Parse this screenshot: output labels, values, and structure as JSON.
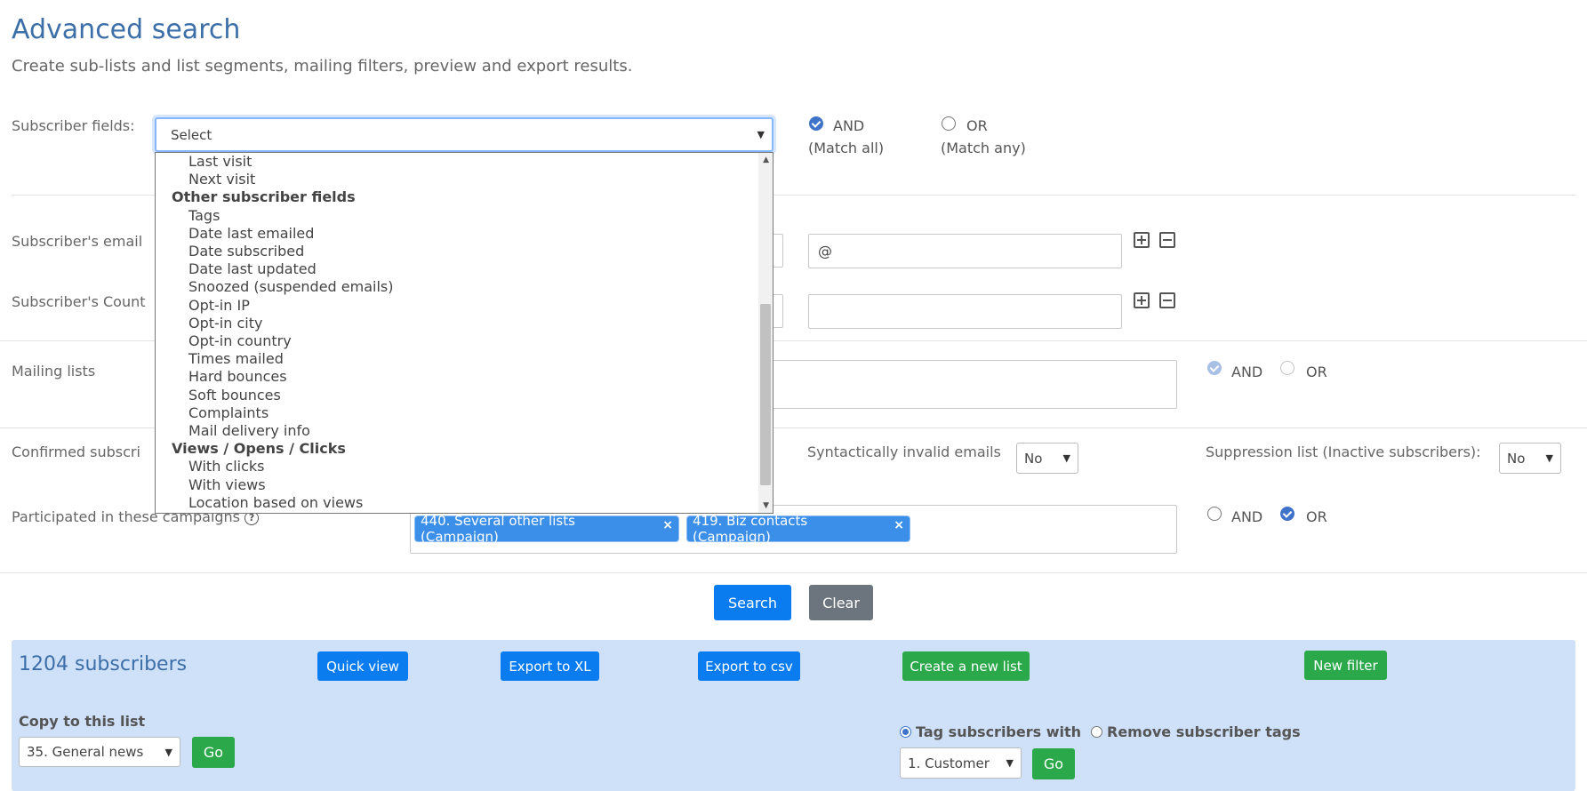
{
  "header": {
    "title": "Advanced search",
    "subtitle": "Create sub-lists and list segments, mailing filters, preview and export results."
  },
  "subscriber_fields": {
    "label": "Subscriber fields:",
    "select_value": "Select",
    "and_label": "AND",
    "and_sub": "(Match all)",
    "or_label": "OR",
    "or_sub": "(Match any)"
  },
  "dropdown": {
    "items": [
      {
        "type": "item",
        "label": "Last visit"
      },
      {
        "type": "item",
        "label": "Next visit"
      },
      {
        "type": "group",
        "label": "Other subscriber fields"
      },
      {
        "type": "item",
        "label": "Tags"
      },
      {
        "type": "item",
        "label": "Date last emailed"
      },
      {
        "type": "item",
        "label": "Date subscribed"
      },
      {
        "type": "item",
        "label": "Date last updated"
      },
      {
        "type": "item",
        "label": "Snoozed (suspended emails)"
      },
      {
        "type": "item",
        "label": "Opt-in IP"
      },
      {
        "type": "item",
        "label": "Opt-in city"
      },
      {
        "type": "item",
        "label": "Opt-in country"
      },
      {
        "type": "item",
        "label": "Times mailed"
      },
      {
        "type": "item",
        "label": "Hard bounces"
      },
      {
        "type": "item",
        "label": "Soft bounces"
      },
      {
        "type": "item",
        "label": "Complaints"
      },
      {
        "type": "item",
        "label": "Mail delivery info"
      },
      {
        "type": "group",
        "label": "Views / Opens / Clicks"
      },
      {
        "type": "item",
        "label": "With clicks"
      },
      {
        "type": "item",
        "label": "With views"
      },
      {
        "type": "item",
        "label": "Location based on views"
      }
    ]
  },
  "filters": {
    "email_label": "Subscriber's email",
    "email_value": "@",
    "country_label": "Subscriber's Count",
    "country_value": ""
  },
  "mailing_lists": {
    "label": "Mailing lists",
    "and_label": "AND",
    "or_label": "OR"
  },
  "confirmed": {
    "label": "Confirmed subscri",
    "invalid_label": "Syntactically invalid emails",
    "invalid_value": "No",
    "suppression_label": "Suppression list (Inactive subscribers):",
    "suppression_value": "No"
  },
  "campaigns": {
    "label": "Participated in these campaigns",
    "help_icon": "?",
    "tags": [
      "440. Several other lists (Campaign)",
      "419. Biz contacts (Campaign)"
    ],
    "tag_remove": "×",
    "and_label": "AND",
    "or_label": "OR"
  },
  "actions": {
    "search": "Search",
    "clear": "Clear"
  },
  "results": {
    "count_text": "1204 subscribers",
    "quick_view": "Quick view",
    "export_xl": "Export to XL",
    "export_csv": "Export to csv",
    "create_list": "Create a new list",
    "new_filter": "New filter",
    "copy_label": "Copy to this list",
    "copy_value": "35. General news",
    "copy_go": "Go",
    "tag_option": "Tag subscribers with",
    "remove_option": "Remove subscriber tags",
    "tag_value": "1. Customer",
    "tag_go": "Go"
  },
  "colors": {
    "title": "#3c6ea8",
    "primary": "#0a7cf0",
    "success": "#2aa84a",
    "secondary": "#6c757d",
    "panel": "#cfe0f9"
  }
}
